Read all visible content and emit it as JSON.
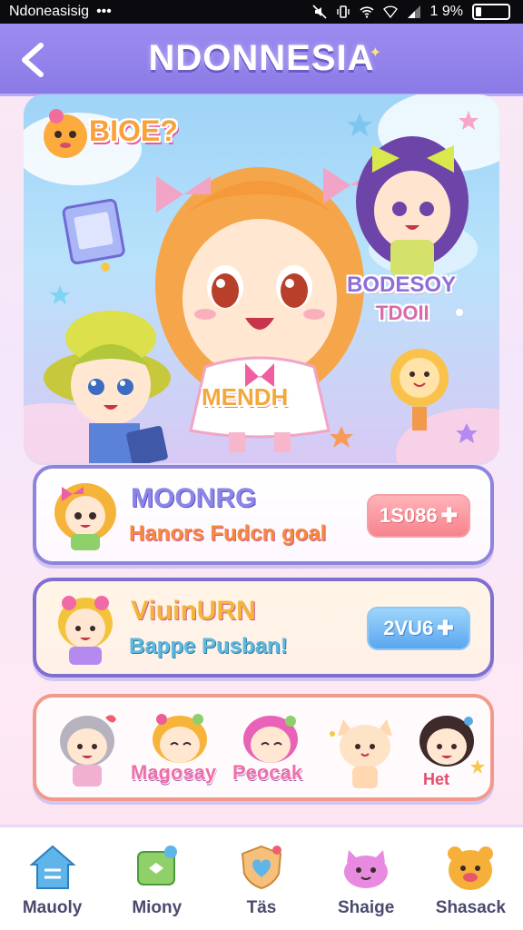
{
  "status_bar": {
    "carrier": "Ndoneasisig",
    "dots": "•••",
    "battery_text": "1 9%",
    "battery_level_pct": 19
  },
  "header": {
    "title": "NDONNESIA",
    "back_icon": "chevron-left-icon",
    "bg_color": "#9d8cf0"
  },
  "hero": {
    "title_top_left": "BIOE?",
    "label_right_1": "BODESOY",
    "label_right_2": "TDOII",
    "label_center": "MENDH"
  },
  "cards": [
    {
      "title": "MOONRG",
      "subtitle": "Hanors Fudcn goal",
      "price": "1S086",
      "price_icon": "plus-icon",
      "price_color": "#f7838d"
    },
    {
      "title": "ViuinURN",
      "subtitle": "Bappe Pusban!",
      "price": "2VU6",
      "price_icon": "plus-icon",
      "price_color": "#5ba6ef"
    }
  ],
  "character_strip": {
    "labels": [
      "Magosay",
      "Peocak",
      "Het"
    ]
  },
  "bottom_nav": [
    {
      "label": "Mauoly",
      "icon": "home-icon"
    },
    {
      "label": "Miony",
      "icon": "chat-icon"
    },
    {
      "label": "Täs",
      "icon": "heart-shield-icon"
    },
    {
      "label": "Shaige",
      "icon": "cat-icon"
    },
    {
      "label": "Shasack",
      "icon": "bear-icon"
    }
  ]
}
